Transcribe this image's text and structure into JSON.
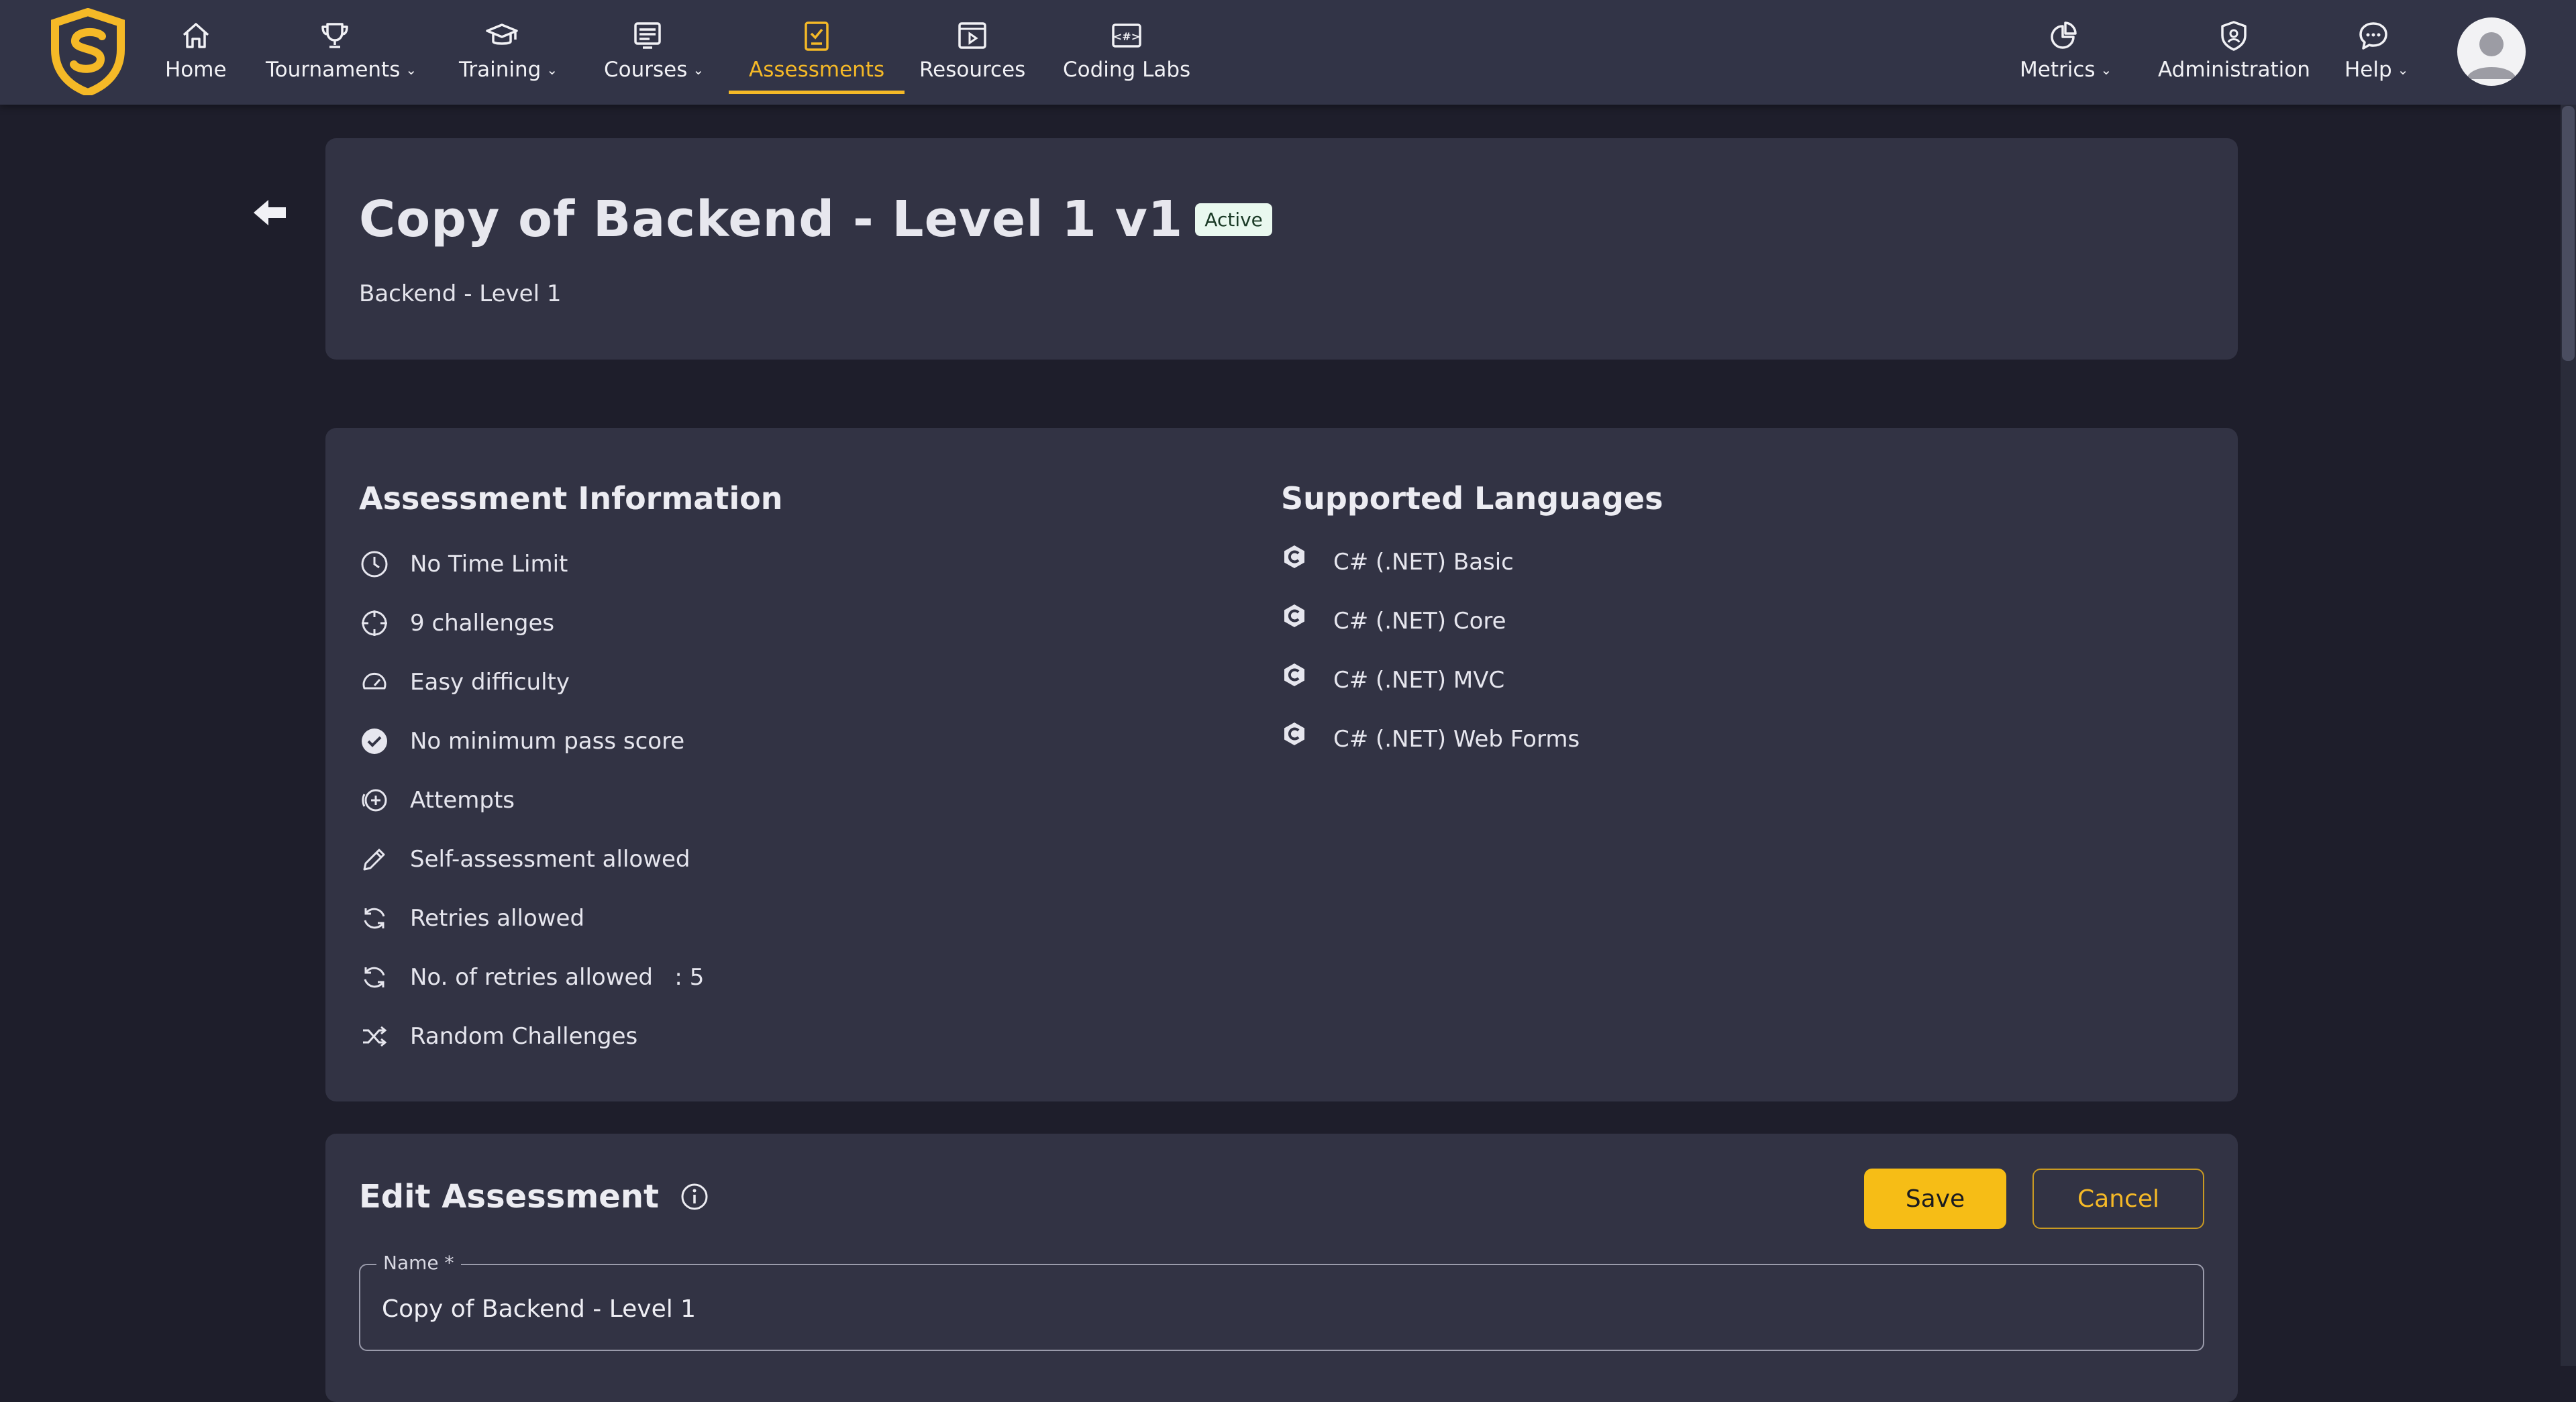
{
  "colors": {
    "accent": "#f5b927",
    "nav_bg": "#323447",
    "page_bg": "#1e1e2b",
    "card_bg": "#323344"
  },
  "nav": {
    "items": [
      {
        "label": "Home",
        "icon": "home-icon",
        "dropdown": false,
        "active": false
      },
      {
        "label": "Tournaments",
        "icon": "trophy-icon",
        "dropdown": true,
        "active": false
      },
      {
        "label": "Training",
        "icon": "graduation-cap-icon",
        "dropdown": true,
        "active": false
      },
      {
        "label": "Courses",
        "icon": "courses-icon",
        "dropdown": true,
        "active": false
      },
      {
        "label": "Assessments",
        "icon": "assessment-icon",
        "dropdown": false,
        "active": true
      },
      {
        "label": "Resources",
        "icon": "video-play-icon",
        "dropdown": false,
        "active": false
      },
      {
        "label": "Coding Labs",
        "icon": "code-lab-icon",
        "dropdown": false,
        "active": false
      }
    ],
    "right_items": [
      {
        "label": "Metrics",
        "icon": "pie-chart-icon",
        "dropdown": true
      },
      {
        "label": "Administration",
        "icon": "admin-shield-icon",
        "dropdown": false
      },
      {
        "label": "Help",
        "icon": "chat-bubble-icon",
        "dropdown": true
      }
    ]
  },
  "header": {
    "title": "Copy of Backend - Level 1 v1",
    "status": "Active",
    "subtitle": "Backend - Level 1"
  },
  "info": {
    "title": "Assessment Information",
    "items": [
      {
        "icon": "clock-icon",
        "text": "No Time Limit"
      },
      {
        "icon": "crosshair-icon",
        "text": "9 challenges"
      },
      {
        "icon": "speedometer-icon",
        "text": "Easy difficulty"
      },
      {
        "icon": "check-circle-icon",
        "text": "No minimum pass score"
      },
      {
        "icon": "attempts-icon",
        "text": "Attempts"
      },
      {
        "icon": "pencil-icon",
        "text": "Self-assessment allowed"
      },
      {
        "icon": "refresh-icon",
        "text": "Retries allowed"
      },
      {
        "icon": "refresh-icon",
        "text": "No. of retries allowed   : 5"
      },
      {
        "icon": "shuffle-icon",
        "text": "Random Challenges"
      }
    ]
  },
  "languages": {
    "title": "Supported Languages",
    "items": [
      {
        "icon": "csharp-icon",
        "text": "C# (.NET) Basic"
      },
      {
        "icon": "csharp-icon",
        "text": "C# (.NET) Core"
      },
      {
        "icon": "csharp-icon",
        "text": "C# (.NET) MVC"
      },
      {
        "icon": "csharp-icon",
        "text": "C# (.NET) Web Forms"
      }
    ]
  },
  "edit": {
    "title": "Edit Assessment",
    "save_label": "Save",
    "cancel_label": "Cancel",
    "name_label": "Name *",
    "name_value": "Copy of Backend - Level 1"
  }
}
